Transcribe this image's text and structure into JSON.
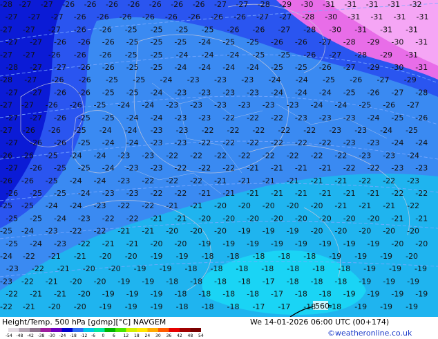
{
  "header": {
    "title": "Height/Temp. 500 hPa [gdmp][°C] NAVGEM",
    "valid_time": "We 14-01-2026 06:00 UTC (00+174)",
    "credit": "©weatheronline.co.uk"
  },
  "colorbar": {
    "ticks": [
      "-54",
      "-48",
      "-42",
      "-38",
      "-30",
      "-24",
      "-18",
      "-12",
      "-6",
      "0",
      "6",
      "12",
      "18",
      "24",
      "30",
      "36",
      "42",
      "48",
      "54"
    ],
    "colors": [
      "#e3dbe3",
      "#b4a5b4",
      "#8d748d",
      "#9e1e9e",
      "#6e00be",
      "#0000cd",
      "#2e6ef2",
      "#00c8e6",
      "#00e6a0",
      "#00b400",
      "#46e600",
      "#d2f000",
      "#ffe600",
      "#ffaa00",
      "#ff5a00",
      "#e60000",
      "#a00000",
      "#780000"
    ]
  },
  "contour_labels": {
    "rows": [
      {
        "v": [
          "-28",
          "-27",
          "-27",
          "-26",
          "-26",
          "-26",
          "-26",
          "-26",
          "-26",
          "-26",
          "-27",
          "-27",
          "-28",
          "-29",
          "-30",
          "-31",
          "-31",
          "-31",
          "-31",
          "-32"
        ]
      },
      {
        "v": [
          "-27",
          "-27",
          "-27",
          "-26",
          "-26",
          "-26",
          "-26",
          "-26",
          "-26",
          "-26",
          "-26",
          "-27",
          "-27",
          "-28",
          "-30",
          "-31",
          "-31",
          "-31",
          "-31"
        ]
      },
      {
        "v": [
          "-27",
          "-27",
          "-27",
          "-26",
          "-26",
          "-25",
          "-25",
          "-25",
          "-25",
          "-26",
          "-26",
          "-27",
          "-28",
          "-30",
          "-31",
          "-31",
          "-31"
        ]
      },
      {
        "v": [
          "-27",
          "-27",
          "-26",
          "-26",
          "-26",
          "-25",
          "-25",
          "-25",
          "-24",
          "-25",
          "-25",
          "-26",
          "-26",
          "-27",
          "-28",
          "-29",
          "-30",
          "-31"
        ]
      },
      {
        "v": [
          "-27",
          "-27",
          "-26",
          "-26",
          "-26",
          "-25",
          "-25",
          "-24",
          "-24",
          "-24",
          "-25",
          "-25",
          "-26",
          "-27",
          "-28",
          "-29",
          "-31"
        ]
      },
      {
        "v": [
          "-28",
          "-27",
          "-27",
          "-26",
          "-26",
          "-25",
          "-25",
          "-24",
          "-24",
          "-24",
          "-24",
          "-25",
          "-25",
          "-26",
          "-27",
          "-29",
          "-30",
          "-31"
        ]
      },
      {
        "v": [
          "-28",
          "-27",
          "-26",
          "-26",
          "-25",
          "-25",
          "-24",
          "-23",
          "-23",
          "-23",
          "-24",
          "-24",
          "-25",
          "-26",
          "-27",
          "-29"
        ]
      },
      {
        "v": [
          "-27",
          "-27",
          "-26",
          "-26",
          "-25",
          "-25",
          "-24",
          "-23",
          "-23",
          "-23",
          "-23",
          "-24",
          "-24",
          "-24",
          "-25",
          "-26",
          "-27",
          "-28"
        ]
      },
      {
        "v": [
          "-27",
          "-27",
          "-26",
          "-26",
          "-25",
          "-24",
          "-24",
          "-23",
          "-23",
          "-23",
          "-23",
          "-23",
          "-23",
          "-24",
          "-24",
          "-25",
          "-26",
          "-27"
        ]
      },
      {
        "v": [
          "-27",
          "-27",
          "-26",
          "-25",
          "-25",
          "-24",
          "-24",
          "-23",
          "-23",
          "-22",
          "-22",
          "-22",
          "-23",
          "-23",
          "-23",
          "-24",
          "-25",
          "-26"
        ]
      },
      {
        "v": [
          "-27",
          "-26",
          "-26",
          "-25",
          "-24",
          "-24",
          "-23",
          "-23",
          "-22",
          "-22",
          "-22",
          "-22",
          "-22",
          "-23",
          "-23",
          "-24",
          "-25"
        ]
      },
      {
        "v": [
          "-27",
          "-26",
          "-26",
          "-25",
          "-24",
          "-24",
          "-23",
          "-23",
          "-22",
          "-22",
          "-22",
          "-22",
          "-22",
          "-22",
          "-23",
          "-23",
          "-24",
          "-24"
        ]
      },
      {
        "v": [
          "-26",
          "-26",
          "-25",
          "-24",
          "-24",
          "-23",
          "-23",
          "-22",
          "-22",
          "-22",
          "-22",
          "-22",
          "-22",
          "-22",
          "-22",
          "-23",
          "-23",
          "-24"
        ]
      },
      {
        "v": [
          "-27",
          "-26",
          "-25",
          "-25",
          "-24",
          "-23",
          "-23",
          "-22",
          "-22",
          "-22",
          "-21",
          "-21",
          "-21",
          "-21",
          "-22",
          "-22",
          "-23",
          "-23"
        ]
      },
      {
        "v": [
          "-26",
          "-26",
          "-25",
          "-24",
          "-24",
          "-23",
          "-22",
          "-22",
          "-22",
          "-21",
          "-21",
          "-21",
          "-21",
          "-21",
          "-21",
          "-22",
          "-22",
          "-23"
        ]
      },
      {
        "v": [
          "-26",
          "-25",
          "-25",
          "-24",
          "-23",
          "-23",
          "-22",
          "-22",
          "-21",
          "-21",
          "-21",
          "-21",
          "-21",
          "-21",
          "-21",
          "-21",
          "-22",
          "-22"
        ]
      },
      {
        "v": [
          "-25",
          "-25",
          "-24",
          "-24",
          "-23",
          "-22",
          "-22",
          "-21",
          "-21",
          "-20",
          "-20",
          "-20",
          "-20",
          "-20",
          "-21",
          "-21",
          "-21",
          "-22"
        ]
      },
      {
        "v": [
          "-25",
          "-25",
          "-24",
          "-23",
          "-22",
          "-22",
          "-21",
          "-21",
          "-20",
          "-20",
          "-20",
          "-20",
          "-20",
          "-20",
          "-20",
          "-20",
          "-21",
          "-21"
        ]
      },
      {
        "v": [
          "-25",
          "-24",
          "-23",
          "-22",
          "-22",
          "-21",
          "-21",
          "-20",
          "-20",
          "-20",
          "-19",
          "-19",
          "-19",
          "-20",
          "-20",
          "-20",
          "-20",
          "-20"
        ]
      },
      {
        "v": [
          "-25",
          "-24",
          "-23",
          "-22",
          "-21",
          "-21",
          "-20",
          "-20",
          "-19",
          "-19",
          "-19",
          "-19",
          "-19",
          "-19",
          "-19",
          "-19",
          "-20",
          "-20"
        ]
      },
      {
        "v": [
          "-24",
          "-22",
          "-21",
          "-21",
          "-20",
          "-20",
          "-19",
          "-19",
          "-18",
          "-18",
          "-18",
          "-18",
          "-18",
          "-19",
          "-19",
          "-19",
          "-20"
        ]
      },
      {
        "v": [
          "-23",
          "-22",
          "-21",
          "-20",
          "-20",
          "-19",
          "-19",
          "-18",
          "-18",
          "-18",
          "-18",
          "-18",
          "-18",
          "-18",
          "-19",
          "-19",
          "-19"
        ]
      },
      {
        "v": [
          "-23",
          "-22",
          "-21",
          "-20",
          "-20",
          "-19",
          "-19",
          "-18",
          "-18",
          "-18",
          "-18",
          "-17",
          "-18",
          "-18",
          "-18",
          "-19",
          "-19",
          "-19"
        ]
      },
      {
        "v": [
          "-22",
          "-21",
          "-21",
          "-20",
          "-19",
          "-19",
          "-19",
          "-18",
          "-18",
          "-18",
          "-18",
          "-17",
          "-18",
          "-18",
          "-19",
          "-19",
          "-19",
          "-19"
        ]
      },
      {
        "v": [
          "-22",
          "-21",
          "-20",
          "-20",
          "-19",
          "-19",
          "-19",
          "-18",
          "-18",
          "-18",
          "-17",
          "-17",
          "-18",
          "-18",
          "-19",
          "-19",
          "-19"
        ]
      }
    ],
    "geopotential_label": "560"
  },
  "colors": {
    "deep_blue": "#0b1bd6",
    "mid_blue": "#2a55f0",
    "light_blue": "#3a87f2",
    "cyan": "#27b6f0",
    "bright_cyan": "#17d9f5",
    "magenta": "#f07ef0",
    "pink": "#f5b0f5"
  }
}
